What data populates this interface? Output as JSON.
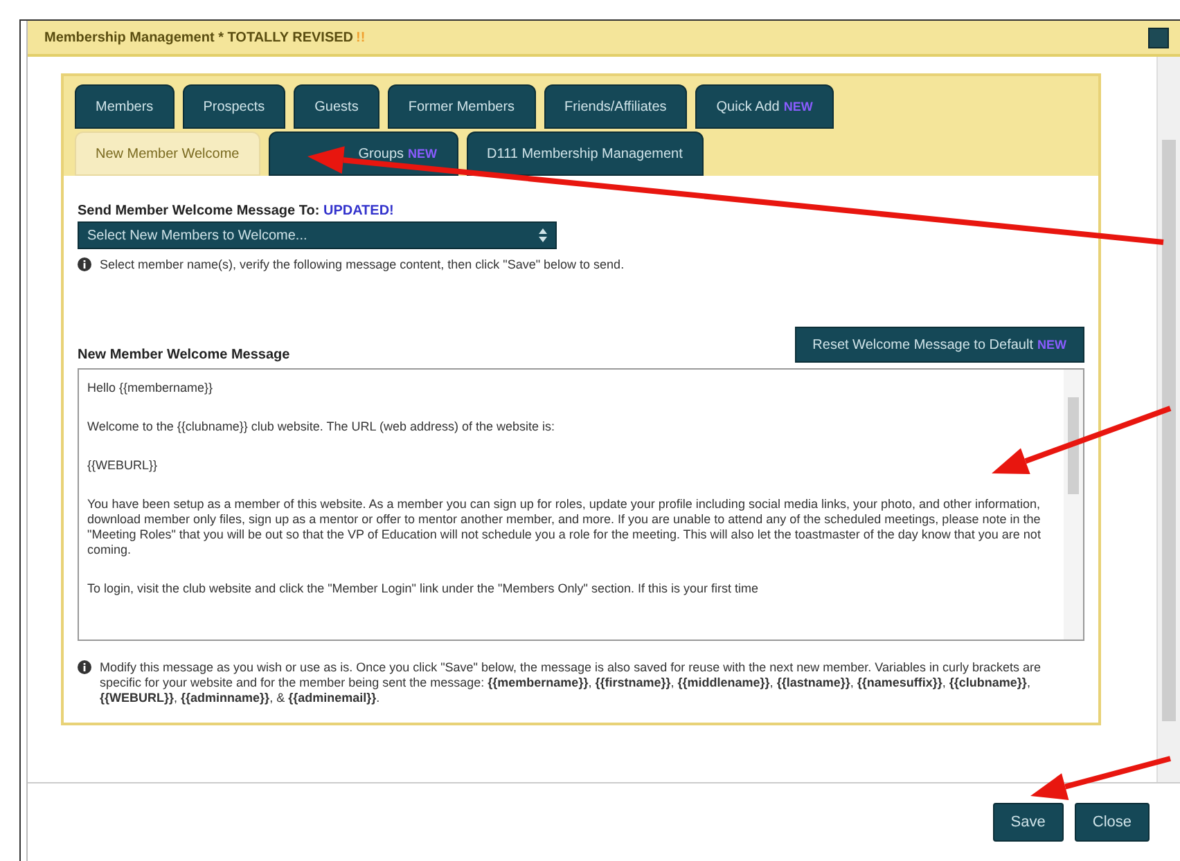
{
  "window": {
    "title": "Membership Management * TOTALLY REVISED",
    "title_mark": "!!"
  },
  "tab_rows": [
    [
      {
        "label": "Members",
        "selected": false
      },
      {
        "label": "Prospects",
        "selected": false
      },
      {
        "label": "Guests",
        "selected": false
      },
      {
        "label": "Former Members",
        "selected": false
      },
      {
        "label": "Friends/Affiliates",
        "selected": false
      },
      {
        "label": "Quick Add",
        "badge": "NEW",
        "selected": false
      }
    ],
    [
      {
        "label": "New Member Welcome",
        "selected": true
      },
      {
        "label": "Groups",
        "badge": "NEW",
        "selected": false
      },
      {
        "label": "D111 Membership Management",
        "selected": false
      }
    ]
  ],
  "send": {
    "label": "Send Member Welcome Message To:",
    "updated": "UPDATED!",
    "select_placeholder": "Select New Members to Welcome...",
    "hint": "Select member name(s), verify the following message content, then click \"Save\" below to send."
  },
  "message": {
    "heading": "New Member Welcome Message",
    "reset_button": "Reset Welcome Message to Default",
    "reset_badge": "NEW",
    "paragraphs": [
      "Hello {{membername}}",
      "Welcome to the {{clubname}} club website.  The URL (web address) of the website is:",
      "{{WEBURL}}",
      "You have been setup as a member of this website.  As a member you can sign up for roles, update your profile including social media links, your photo, and other information, download member only files, sign up as a mentor or offer to mentor another member, and more.  If you are unable to attend any of the scheduled meetings, please note in the \"Meeting Roles\" that you will be out so that the VP of Education will not schedule you a role for the meeting.  This will also let the toastmaster of the day know that you are not coming.",
      "To login, visit the club website and click the \"Member Login\" link under the \"Members Only\" section.  If this is your first time"
    ]
  },
  "note": "Modify this message as you wish or use as is. Once you click \"Save\" below, the message is also saved for reuse with the next new member. Variables in curly brackets are specific for your website and for the member being sent the message: **{{membername}}**, **{{firstname}}**, **{{middlename}}**, **{{lastname}}**, **{{namesuffix}}**, **{{clubname}}**, **{{WEBURL}}**, **{{adminname}}**, & **{{adminemail}}**.",
  "buttons": [
    "Save",
    "Close"
  ]
}
